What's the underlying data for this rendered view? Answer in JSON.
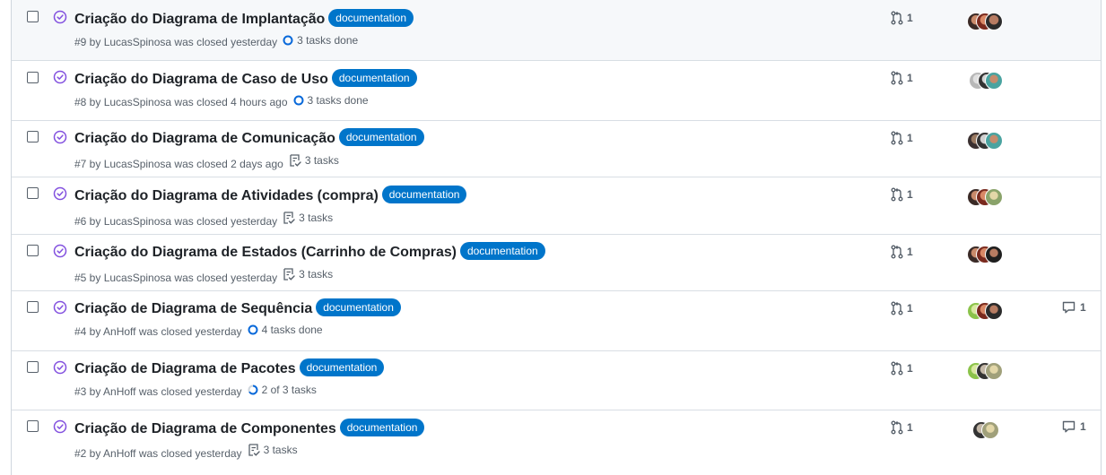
{
  "colors": {
    "closed_purple": "#8250df",
    "label_blue": "#0075ca",
    "meta_gray": "#57606a",
    "progress_blue": "#0969da"
  },
  "issues": [
    {
      "title": "Criação do Diagrama de Implantação",
      "label": "documentation",
      "meta": "#9 by LucasSpinosa was closed yesterday",
      "tasks": "3 tasks done",
      "tasks_icon": "progress-complete-icon",
      "linked_prs": "1",
      "comments": ""
    },
    {
      "title": "Criação do Diagrama de Caso de Uso",
      "label": "documentation",
      "meta": "#8 by LucasSpinosa was closed 4 hours ago",
      "tasks": "3 tasks done",
      "tasks_icon": "progress-complete-icon",
      "linked_prs": "1",
      "comments": ""
    },
    {
      "title": "Criação do Diagrama de Comunicação",
      "label": "documentation",
      "meta": "#7 by LucasSpinosa was closed 2 days ago",
      "tasks": "3 tasks",
      "tasks_icon": "checklist-icon",
      "linked_prs": "1",
      "comments": ""
    },
    {
      "title": "Criação do Diagrama de Atividades (compra)",
      "label": "documentation",
      "meta": "#6 by LucasSpinosa was closed yesterday",
      "tasks": "3 tasks",
      "tasks_icon": "checklist-icon",
      "linked_prs": "1",
      "comments": ""
    },
    {
      "title": "Criação do Diagrama de Estados (Carrinho de Compras)",
      "label": "documentation",
      "meta": "#5 by LucasSpinosa was closed yesterday",
      "tasks": "3 tasks",
      "tasks_icon": "checklist-icon",
      "linked_prs": "1",
      "comments": ""
    },
    {
      "title": "Criação de Diagrama de Sequência",
      "label": "documentation",
      "meta": "#4 by AnHoff was closed yesterday",
      "tasks": "4 tasks done",
      "tasks_icon": "progress-complete-icon",
      "linked_prs": "1",
      "comments": "1"
    },
    {
      "title": "Criação de Diagrama de Pacotes",
      "label": "documentation",
      "meta": "#3 by AnHoff was closed yesterday",
      "tasks": "2 of 3 tasks",
      "tasks_icon": "progress-partial-icon",
      "tasks_progress": 0.67,
      "linked_prs": "1",
      "comments": ""
    },
    {
      "title": "Criação de Diagrama de Componentes",
      "label": "documentation",
      "meta": "#2 by AnHoff was closed yesterday",
      "tasks": "3 tasks",
      "tasks_icon": "checklist-icon",
      "linked_prs": "1",
      "comments": "1"
    }
  ]
}
